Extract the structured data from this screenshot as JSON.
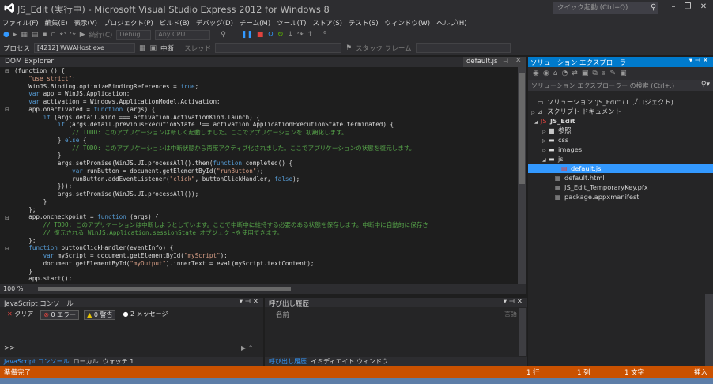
{
  "window": {
    "title": "JS_Edit (実行中) - Microsoft Visual Studio Express 2012 for Windows 8",
    "quick_launch_placeholder": "クイック起動 (Ctrl+Q)"
  },
  "menu": [
    "ファイル(F)",
    "編集(E)",
    "表示(V)",
    "プロジェクト(P)",
    "ビルド(B)",
    "デバッグ(D)",
    "チーム(M)",
    "ツール(T)",
    "ストア(S)",
    "テスト(S)",
    "ウィンドウ(W)",
    "ヘルプ(H)"
  ],
  "toolbar": {
    "continue_label": "続行(C)",
    "config": "Debug",
    "platform": "Any CPU",
    "process_label": "プロセス",
    "process_value": "[4212] WWAHost.exe",
    "suspend_label": "中断",
    "thread_label": "スレッド",
    "stack_frame_label": "スタック フレーム"
  },
  "dom_explorer": {
    "title": "DOM Explorer",
    "file_tab": "default.js"
  },
  "editor": {
    "zoom": "100 %",
    "lines": [
      [
        [
          "",
          "(function () {"
        ]
      ],
      [
        [
          "",
          "    "
        ],
        [
          "str",
          "\"use strict\""
        ],
        [
          "",
          ";"
        ]
      ],
      [
        [
          "",
          "    WinJS.Binding.optimizeBindingReferences = "
        ],
        [
          "kw",
          "true"
        ],
        [
          "",
          ";"
        ]
      ],
      [
        [
          "",
          "    "
        ],
        [
          "kw",
          "var"
        ],
        [
          "",
          " app = WinJS.Application;"
        ]
      ],
      [
        [
          "",
          "    "
        ],
        [
          "kw",
          "var"
        ],
        [
          "",
          " activation = Windows.ApplicationModel.Activation;"
        ]
      ],
      [
        [
          "",
          "    app.onactivated = "
        ],
        [
          "kw",
          "function"
        ],
        [
          "",
          " (args) {"
        ]
      ],
      [
        [
          "",
          "        "
        ],
        [
          "kw",
          "if"
        ],
        [
          "",
          " (args.detail.kind === activation.ActivationKind.launch) {"
        ]
      ],
      [
        [
          "",
          "            "
        ],
        [
          "kw",
          "if"
        ],
        [
          "",
          " (args.detail.previousExecutionState !== activation.ApplicationExecutionState.terminated) {"
        ]
      ],
      [
        [
          "",
          "                "
        ],
        [
          "cmt",
          "// TODO: このアプリケーションは新しく起動しました。ここでアプリケーションを 初期化します。"
        ]
      ],
      [
        [
          "",
          "            } "
        ],
        [
          "kw",
          "else"
        ],
        [
          "",
          " {"
        ]
      ],
      [
        [
          "",
          "                "
        ],
        [
          "cmt",
          "// TODO: このアプリケーションは中断状態から再度アクティブ化されました。ここでアプリケーションの状態を復元します。"
        ]
      ],
      [
        [
          "",
          "            }"
        ]
      ],
      [
        [
          "",
          "            args.setPromise(WinJS.UI.processAll().then("
        ],
        [
          "kw",
          "function"
        ],
        [
          "",
          " completed() {"
        ]
      ],
      [
        [
          "",
          "                "
        ],
        [
          "kw",
          "var"
        ],
        [
          "",
          " runButton = document.getElementById("
        ],
        [
          "str",
          "\"runButton\""
        ],
        [
          "",
          ");"
        ]
      ],
      [
        [
          "",
          "                runButton.addEventListener("
        ],
        [
          "str",
          "\"click\""
        ],
        [
          "",
          ", buttonClickHandler, "
        ],
        [
          "kw",
          "false"
        ],
        [
          "",
          ");"
        ]
      ],
      [
        [
          "",
          "            }));"
        ]
      ],
      [
        [
          "",
          "            args.setPromise(WinJS.UI.processAll());"
        ]
      ],
      [
        [
          "",
          "        }"
        ]
      ],
      [
        [
          "",
          "    };"
        ]
      ],
      [
        [
          "",
          "    app.oncheckpoint = "
        ],
        [
          "kw",
          "function"
        ],
        [
          "",
          " (args) {"
        ]
      ],
      [
        [
          "",
          "        "
        ],
        [
          "cmt",
          "// TODO: このアプリケーションは中断しようとしています。ここで中断中に維持する必要のある状態を保存します。中断中に自動的に保存さ"
        ]
      ],
      [
        [
          "",
          "        "
        ],
        [
          "cmt",
          "// 復元される WinJS.Application.sessionState オブジェクトを使用できます。"
        ]
      ],
      [
        [
          "",
          "    };"
        ]
      ],
      [
        [
          "",
          "    "
        ],
        [
          "kw",
          "function"
        ],
        [
          "",
          " buttonClickHandler(eventInfo) {"
        ]
      ],
      [
        [
          "",
          "        "
        ],
        [
          "kw",
          "var"
        ],
        [
          "",
          " myScript = document.getElementById("
        ],
        [
          "str",
          "\"myScript\""
        ],
        [
          "",
          ");"
        ]
      ],
      [
        [
          "",
          "        document.getElementById("
        ],
        [
          "str",
          "\"myOutput\""
        ],
        [
          "",
          ").innerText = eval(myScript.textContent);"
        ]
      ],
      [
        [
          "",
          "    }"
        ]
      ],
      [
        [
          "",
          "    app.start();"
        ]
      ],
      [
        [
          "",
          "})();"
        ]
      ]
    ]
  },
  "js_console": {
    "title": "JavaScript コンソール",
    "clear_label": "クリア",
    "errors_label": "0 エラー",
    "warnings_label": "0 警告",
    "messages_label": "2 メッセージ",
    "prompt": ">>",
    "tabs": [
      "JavaScript コンソール",
      "ローカル",
      "ウォッチ 1"
    ]
  },
  "call_stack": {
    "title": "呼び出し履歴",
    "col_name": "名前",
    "col_lang": "言語",
    "tabs": [
      "呼び出し履歴",
      "イミディエイト ウィンドウ"
    ]
  },
  "solution_explorer": {
    "title": "ソリューション エクスプローラー",
    "search_placeholder": "ソリューション エクスプローラー の検索 (Ctrl+;)",
    "items": [
      {
        "label": "ソリューション 'JS_Edit' (1 プロジェクト)",
        "icon": "solution-icon",
        "glyph": "▭",
        "tri": ""
      },
      {
        "label": "スクリプト ドキュメント",
        "icon": "scripts-icon",
        "glyph": "⊿",
        "tri": "▷"
      },
      {
        "label": "JS_Edit",
        "icon": "js-project-icon",
        "glyph": "JS",
        "tri": "◢"
      },
      {
        "label": "参照",
        "icon": "references-icon",
        "glyph": "■",
        "tri": "▷"
      },
      {
        "label": "css",
        "icon": "folder-icon",
        "glyph": "▬",
        "tri": "▷"
      },
      {
        "label": "images",
        "icon": "folder-icon",
        "glyph": "▬",
        "tri": "▷"
      },
      {
        "label": "js",
        "icon": "folder-open-icon",
        "glyph": "▬",
        "tri": "◢"
      },
      {
        "label": "default.js",
        "icon": "js-file-icon",
        "glyph": "▤",
        "tri": ""
      },
      {
        "label": "default.html",
        "icon": "html-file-icon",
        "glyph": "▤",
        "tri": ""
      },
      {
        "label": "JS_Edit_TemporaryKey.pfx",
        "icon": "key-file-icon",
        "glyph": "▤",
        "tri": ""
      },
      {
        "label": "package.appxmanifest",
        "icon": "manifest-icon",
        "glyph": "▤",
        "tri": ""
      }
    ]
  },
  "status": {
    "ready": "準備完了",
    "line": "1 行",
    "column": "1 列",
    "char": "1 文字",
    "mode": "挿入"
  },
  "colors": {
    "accent": "#007acc",
    "status_bar": "#ca5100",
    "selection": "#3399ff"
  }
}
